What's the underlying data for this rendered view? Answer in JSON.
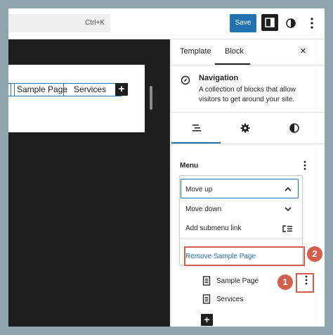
{
  "toolbar": {
    "search_shortcut": "Ctrl+K",
    "save_label": "Save"
  },
  "canvas": {
    "nav_items": [
      "Sample Page",
      "Services"
    ],
    "add_symbol": "+"
  },
  "sidebar": {
    "tabs": [
      "Template",
      "Block"
    ],
    "close_symbol": "×",
    "block": {
      "title": "Navigation",
      "description": "A collection of blocks that allow visitors to get around your site."
    },
    "menu_heading": "Menu",
    "dropdown": {
      "move_up": "Move up",
      "move_down": "Move down",
      "add_submenu": "Add submenu link",
      "remove": "Remove Sample Page"
    },
    "list": [
      "Sample Page",
      "Services"
    ],
    "list_add_symbol": "+"
  },
  "annotations": {
    "badge_1": "1",
    "badge_2": "2"
  },
  "colors": {
    "accent": "#2271b1",
    "annotation": "#d45d4e",
    "dark": "#1e1e1e",
    "backdrop": "#8fa5ad"
  }
}
